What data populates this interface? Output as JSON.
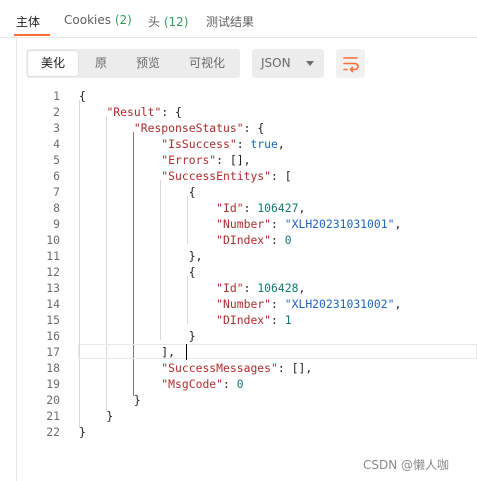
{
  "tabs": [
    {
      "label": "主体",
      "count": ""
    },
    {
      "label": "Cookies",
      "count": "(2)"
    },
    {
      "label": "头",
      "count": "(12)"
    },
    {
      "label": "测试结果",
      "count": ""
    }
  ],
  "view_modes": [
    "美化",
    "原",
    "预览",
    "可视化"
  ],
  "format": {
    "selected": "JSON"
  },
  "editor": {
    "line_numbers": [
      "1",
      "2",
      "3",
      "4",
      "5",
      "6",
      "7",
      "8",
      "9",
      "10",
      "11",
      "12",
      "13",
      "14",
      "15",
      "16",
      "17",
      "18",
      "19",
      "20",
      "21",
      "22"
    ],
    "keys": {
      "result": "\"Result\"",
      "response_status": "\"ResponseStatus\"",
      "is_success": "\"IsSuccess\"",
      "errors": "\"Errors\"",
      "success_entitys": "\"SuccessEntitys\"",
      "id": "\"Id\"",
      "number": "\"Number\"",
      "dindex": "\"DIndex\"",
      "success_messages": "\"SuccessMessages\"",
      "msg_code": "\"MsgCode\""
    },
    "values": {
      "is_success": "true",
      "id_1": "106427",
      "number_1": "\"XLH20231031001\"",
      "dindex_1": "0",
      "id_2": "106428",
      "number_2": "\"XLH20231031002\"",
      "dindex_2": "1",
      "msg_code": "0"
    }
  },
  "watermark": "CSDN @懒人咖",
  "colors": {
    "accent": "#ff6c37",
    "json_key": "#b02c2c",
    "json_string": "#1a66c2",
    "json_number": "#0f7a6e",
    "count": "#3a9a5b"
  }
}
